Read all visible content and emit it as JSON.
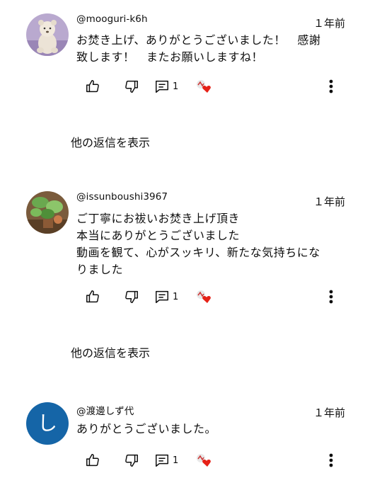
{
  "comments": [
    {
      "author": "@mooguri-k6h",
      "time": "１年前",
      "text": "お焚き上げ、ありがとうございました！　感謝\n致します！　またお願いしますね！",
      "reply_count": "1",
      "replies_label": "他の返信を表示",
      "avatar_icon": "stuffed-bear-photo"
    },
    {
      "author": "@issunboushi3967",
      "time": "１年前",
      "text": "ご丁寧にお祓いお焚き上げ頂き\n本当にありがとうございました\n動画を観て、心がスッキリ、新たな気持ちにな\nりました",
      "reply_count": "1",
      "replies_label": "他の返信を表示",
      "avatar_icon": "plant-photo"
    },
    {
      "author": "@渡邊しず代",
      "time": "１年前",
      "text": "ありがとうございました。",
      "reply_count": "1",
      "avatar_letter": "し",
      "avatar_color": "#1565a7"
    }
  ],
  "icons": {
    "like": "thumbs-up-icon",
    "dislike": "thumbs-down-icon",
    "reply": "comment-icon",
    "creator_heart": "creator-heart-icon",
    "more": "more-vertical-icon"
  },
  "colors": {
    "heart": "#e62117",
    "text": "#0f0f0f"
  }
}
